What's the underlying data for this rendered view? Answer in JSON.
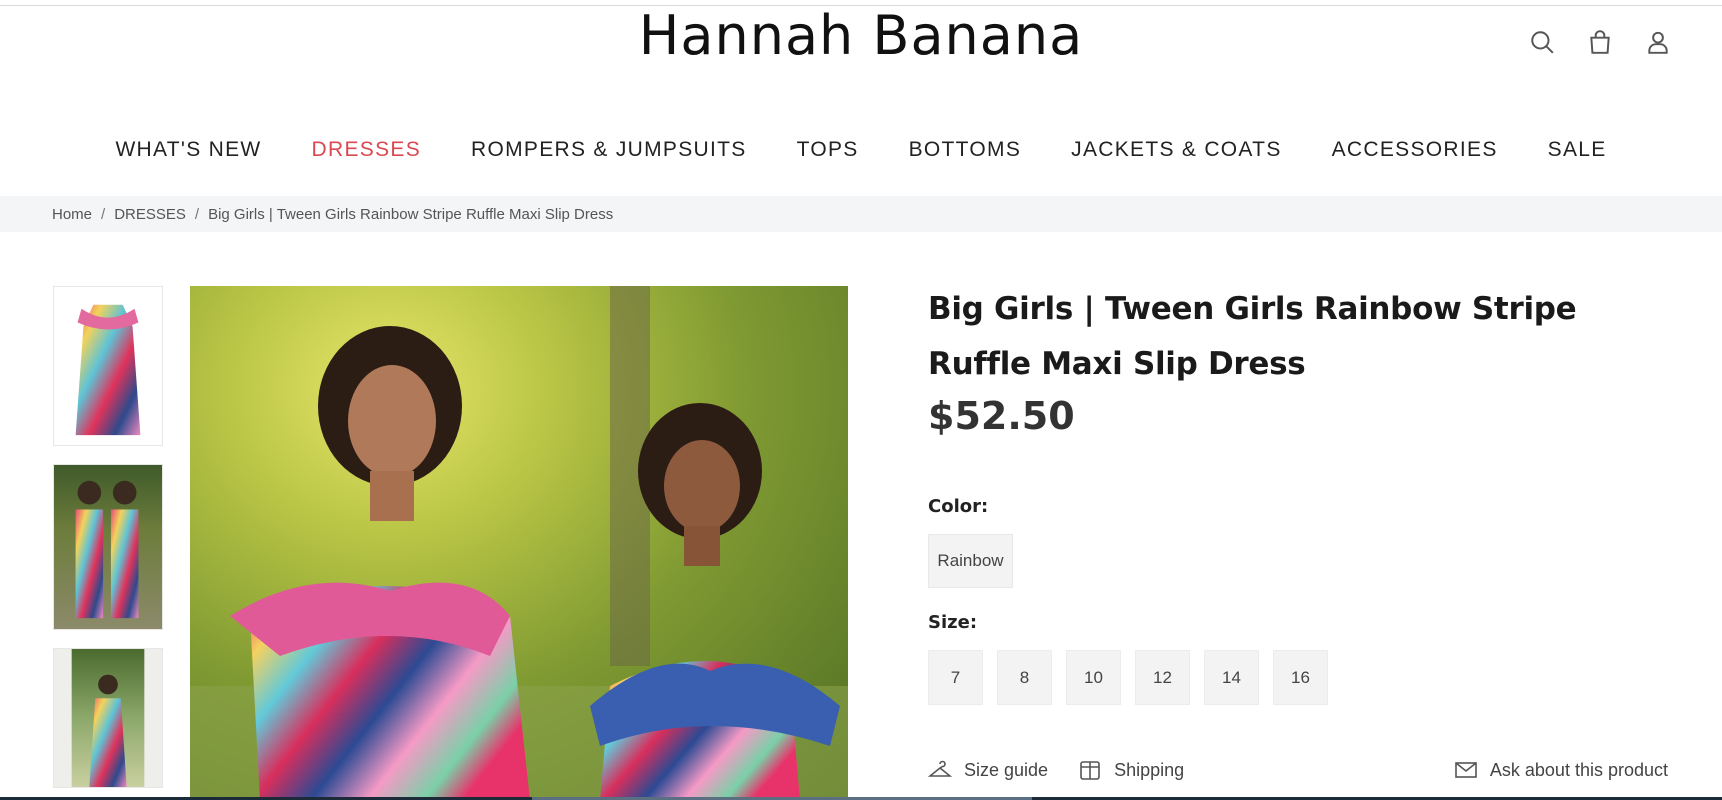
{
  "brand": {
    "logo_text": "Hannah Banana"
  },
  "header_icons": [
    "search-icon",
    "bag-icon",
    "account-icon"
  ],
  "nav": {
    "items": [
      {
        "label": "WHAT'S NEW",
        "active": false
      },
      {
        "label": "DRESSES",
        "active": true
      },
      {
        "label": "ROMPERS & JUMPSUITS",
        "active": false
      },
      {
        "label": "TOPS",
        "active": false
      },
      {
        "label": "BOTTOMS",
        "active": false
      },
      {
        "label": "JACKETS & COATS",
        "active": false
      },
      {
        "label": "ACCESSORIES",
        "active": false
      },
      {
        "label": "SALE",
        "active": false
      }
    ],
    "active_color": "#d9494f"
  },
  "breadcrumb": {
    "items": [
      "Home",
      "DRESSES",
      "Big Girls | Tween Girls Rainbow Stripe Ruffle Maxi Slip Dress"
    ],
    "separator": "/"
  },
  "product": {
    "title": "Big Girls | Tween Girls Rainbow Stripe Ruffle Maxi Slip Dress",
    "price": "$52.50",
    "color_label": "Color:",
    "color_selected": "Rainbow",
    "size_label": "Size:",
    "sizes": [
      "7",
      "8",
      "10",
      "12",
      "14",
      "16"
    ]
  },
  "actions": {
    "size_guide": "Size guide",
    "shipping": "Shipping",
    "ask": "Ask about this product"
  }
}
